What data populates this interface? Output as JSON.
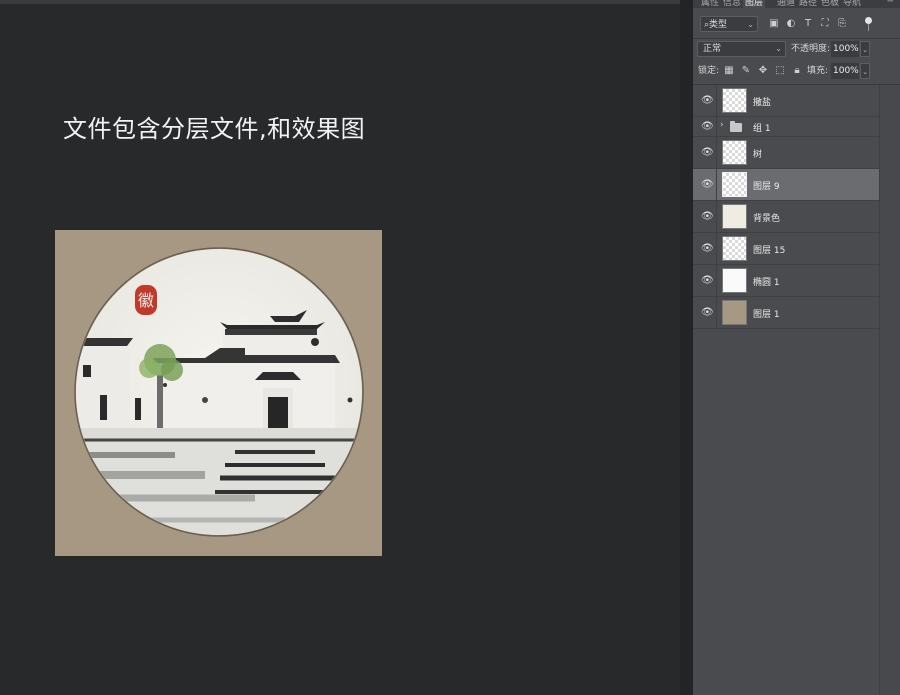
{
  "canvas": {
    "headline": "文件包含分层文件,和效果图",
    "artboard_color": "#a69883",
    "artwork_seal_text": "徽"
  },
  "panel": {
    "tabs": [
      "属性",
      "信息",
      "图层",
      "通道",
      "路径",
      "色板",
      "导航"
    ],
    "active_tab": "图层",
    "menu_icon": "panel-menu-icon",
    "filter": {
      "kind_label": "类型",
      "kind_icon": "search-icon",
      "filter_icons": [
        "image-filter-icon",
        "adjustment-filter-icon",
        "text-filter-icon",
        "shape-filter-icon",
        "smart-object-filter-icon"
      ],
      "toggle_state": "on"
    },
    "blend": {
      "mode": "正常",
      "opacity_label": "不透明度:",
      "opacity_value": "100%"
    },
    "lock": {
      "label": "锁定:",
      "icons": [
        "lock-transparent-pixels-icon",
        "lock-image-pixels-icon",
        "lock-position-icon",
        "lock-artboard-icon",
        "lock-all-icon"
      ],
      "fill_label": "填充:",
      "fill_value": "100%"
    },
    "layers": [
      {
        "name": "撒盐",
        "thumb": "checker",
        "selected": false,
        "group": false
      },
      {
        "name": "组 1",
        "thumb": "folder",
        "selected": false,
        "group": true
      },
      {
        "name": "树",
        "thumb": "checker",
        "selected": false,
        "group": false
      },
      {
        "name": "图层 9",
        "thumb": "checker",
        "selected": true,
        "group": false
      },
      {
        "name": "背景色",
        "thumb": "cream",
        "selected": false,
        "group": false
      },
      {
        "name": "图层 15",
        "thumb": "checker",
        "selected": false,
        "group": false
      },
      {
        "name": "椭圆 1",
        "thumb": "white",
        "selected": false,
        "group": false
      },
      {
        "name": "图层 1",
        "thumb": "tan",
        "selected": false,
        "group": false
      }
    ]
  }
}
